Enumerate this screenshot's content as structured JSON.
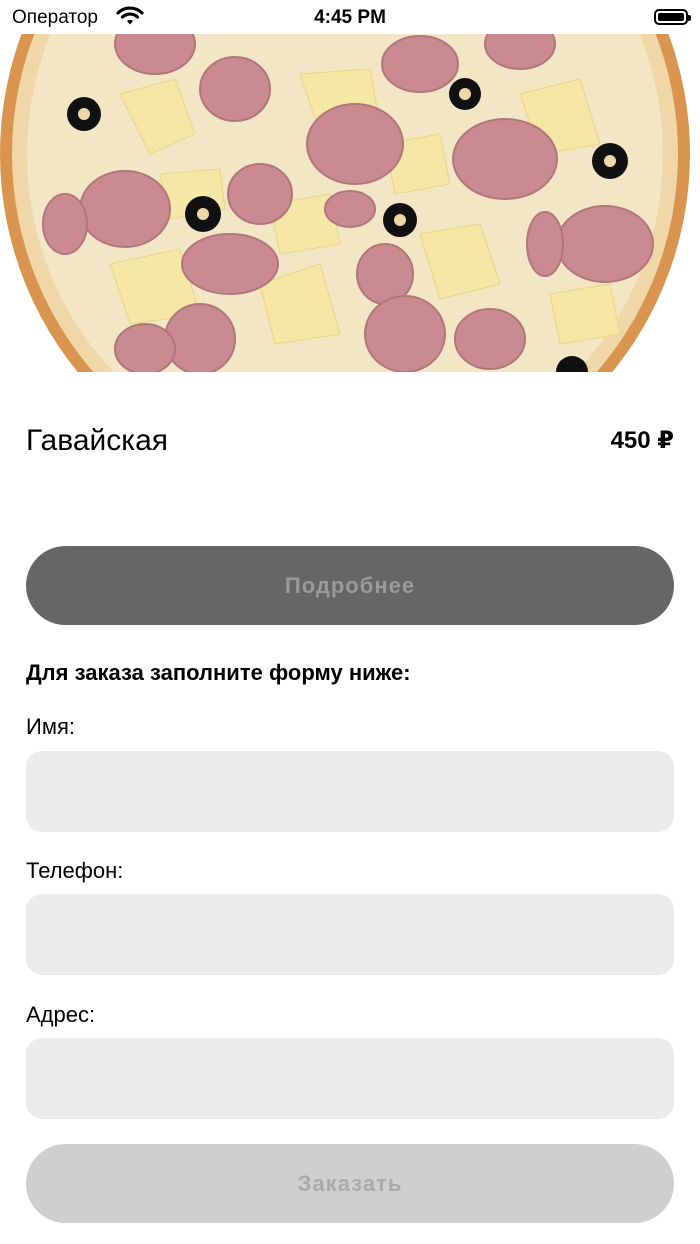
{
  "status_bar": {
    "carrier": "Оператор",
    "time": "4:45 PM",
    "icons": [
      "wifi-icon",
      "battery-icon"
    ]
  },
  "product": {
    "image": "hawaiian-pizza-photo",
    "name": "Гавайская",
    "price": "450 ₽"
  },
  "details_button": {
    "label": "Подробнее"
  },
  "form": {
    "title": "Для заказа заполните форму ниже:",
    "name_label": "Имя:",
    "name_value": "",
    "phone_label": "Телефон:",
    "phone_value": "",
    "address_label": "Адрес:",
    "address_value": ""
  },
  "order_button": {
    "label": "Заказать"
  },
  "colors": {
    "details_button_bg": "#666666",
    "order_button_bg": "#cfcfcf",
    "input_bg": "#ebebeb"
  }
}
